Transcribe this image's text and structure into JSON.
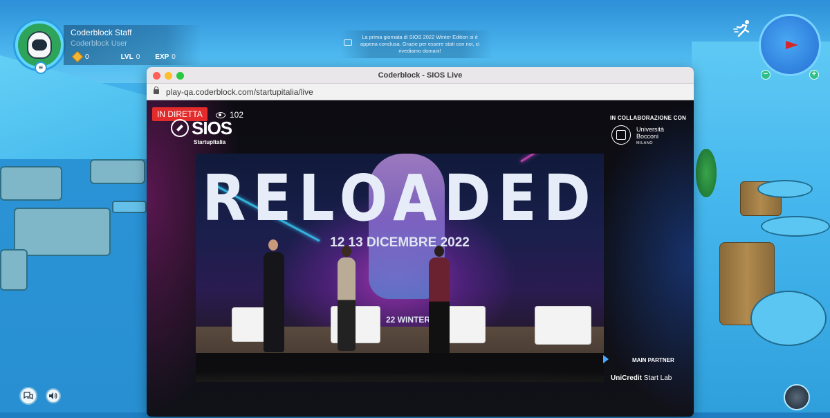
{
  "hud": {
    "user_name": "Coderblock Staff",
    "user_role": "Coderblock User",
    "coins": "0",
    "level_label": "LVL",
    "level_value": "0",
    "exp_label": "EXP",
    "exp_value": "0",
    "notice": "La prima giornata di  SIOS 2022 Winter Edition si è appena conclusa. Grazie per essere stati con noi, ci rivediamo domani!",
    "zoom_out": "−",
    "zoom_in": "+",
    "menu": "≡"
  },
  "window": {
    "title": "Coderblock - SIOS Live",
    "url": "play-qa.coderblock.com/startupitalia/live"
  },
  "stream": {
    "live_badge": "IN DIRETTA",
    "viewers": "102",
    "sios_logo": "SIOS",
    "sios_sub": "StartupItalia",
    "collab_title": "IN COLLABORAZIONE CON",
    "bocconi_name_1": "Università",
    "bocconi_name_2": "Bocconi",
    "bocconi_city": "MILANO",
    "main_partner": "MAIN PARTNER",
    "unicredit_bold": "UniCredit",
    "unicredit_rest": " Start Lab"
  },
  "stage": {
    "headline": "RELOADED",
    "dates": "12 13 DICEMBRE 2022",
    "edition": "22 WINTER E"
  },
  "colors": {
    "live_red": "#e32b2b",
    "hud_green": "#2ea35a",
    "sky_blue": "#3fb0ea"
  },
  "icons": {
    "notice": "envelope-icon",
    "viewers": "eye-icon",
    "coins": "diamond-coin-icon",
    "runner": "runner-icon",
    "chat": "chat-bubbles-icon",
    "sound": "speaker-icon",
    "lock": "lock-icon"
  }
}
